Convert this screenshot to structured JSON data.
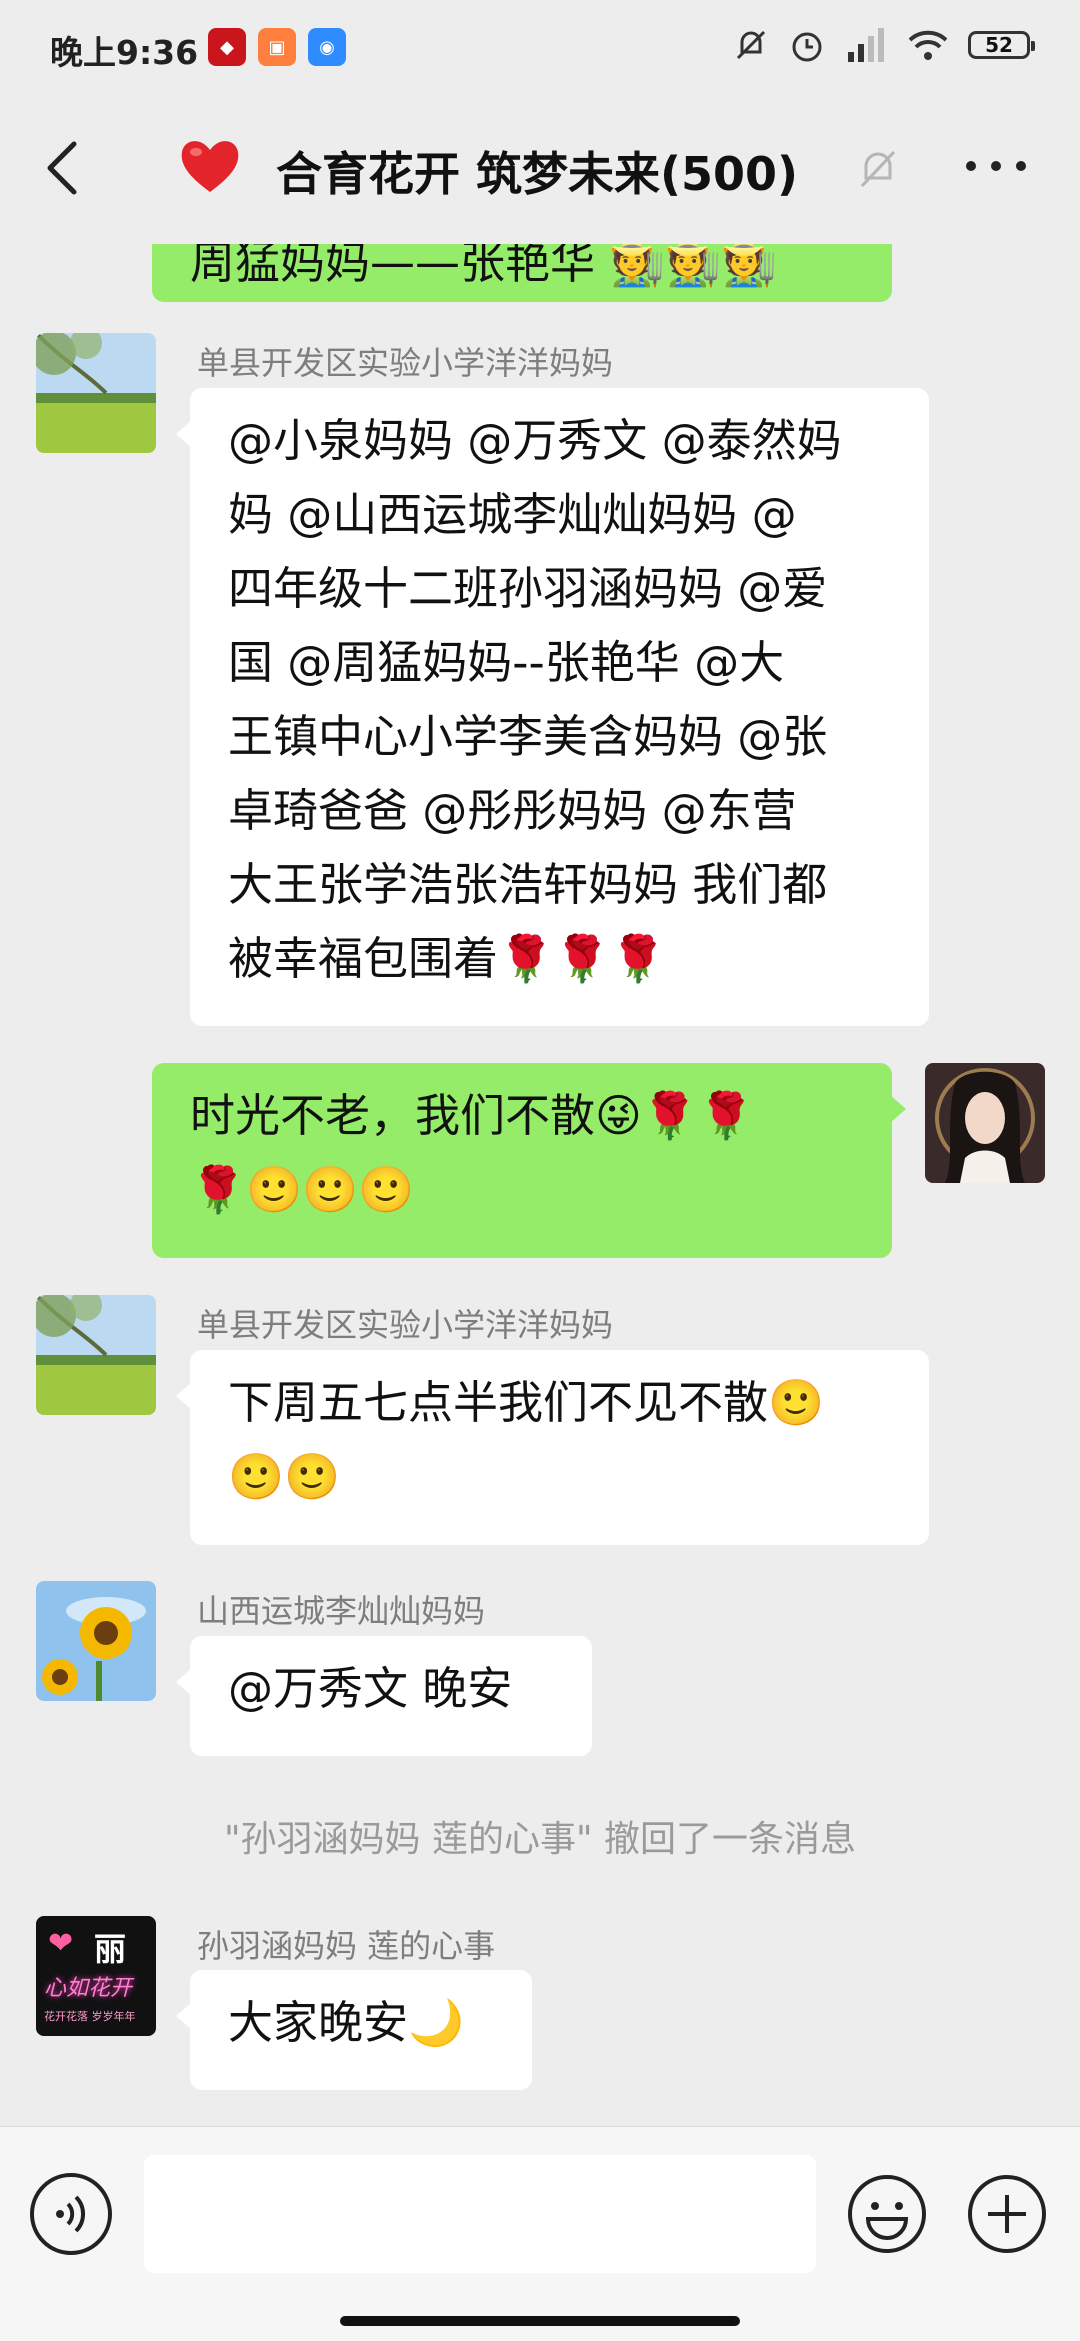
{
  "status_bar": {
    "time": "晚上9:36",
    "app_icons": [
      "news-app-icon",
      "shopping-app-icon",
      "chat-app-icon"
    ],
    "battery": "52"
  },
  "header": {
    "emoji": "❤️",
    "title": "合育花开 筑梦未来(500)"
  },
  "messages": [
    {
      "side": "right",
      "partial": true,
      "text": "周猛妈妈——张艳华 🧑‍🌾🧑‍🌾🧑‍🌾"
    },
    {
      "side": "left",
      "sender": "单县开发区实验小学洋洋妈妈",
      "lines": [
        "@小泉妈妈 @万秀文 @泰然妈",
        "妈 @山西运城李灿灿妈妈 @",
        "四年级十二班孙羽涵妈妈 @爱",
        "国 @周猛妈妈--张艳华 @大",
        "王镇中心小学李美含妈妈 @张",
        "卓琦爸爸 @彤彤妈妈 @东营",
        "大王张学浩张浩轩妈妈 我们都",
        "被幸福包围着🌹🌹🌹"
      ]
    },
    {
      "side": "right",
      "lines": [
        "时光不老，我们不散😜🌹🌹",
        "🌹🙂🙂🙂"
      ]
    },
    {
      "side": "left",
      "sender": "单县开发区实验小学洋洋妈妈",
      "lines": [
        "下周五七点半我们不见不散🙂",
        "🙂🙂"
      ]
    },
    {
      "side": "left",
      "sender": "山西运城李灿灿妈妈",
      "lines": [
        "@万秀文 晚安"
      ]
    },
    {
      "side": "system",
      "text": "\"孙羽涵妈妈 莲的心事\" 撤回了一条消息"
    },
    {
      "side": "left",
      "sender": "孙羽涵妈妈 莲的心事",
      "lines": [
        "大家晚安🌙"
      ]
    }
  ],
  "avatar_text": {
    "neon_top": "丽",
    "neon_mid": "心如花开",
    "neon_small": "花开花落 岁岁年年"
  },
  "input": {
    "placeholder": ""
  },
  "colors": {
    "bg": "#ededed",
    "bubble_self": "#95ec69",
    "bubble_other": "#ffffff",
    "name": "#7e7e7e"
  }
}
